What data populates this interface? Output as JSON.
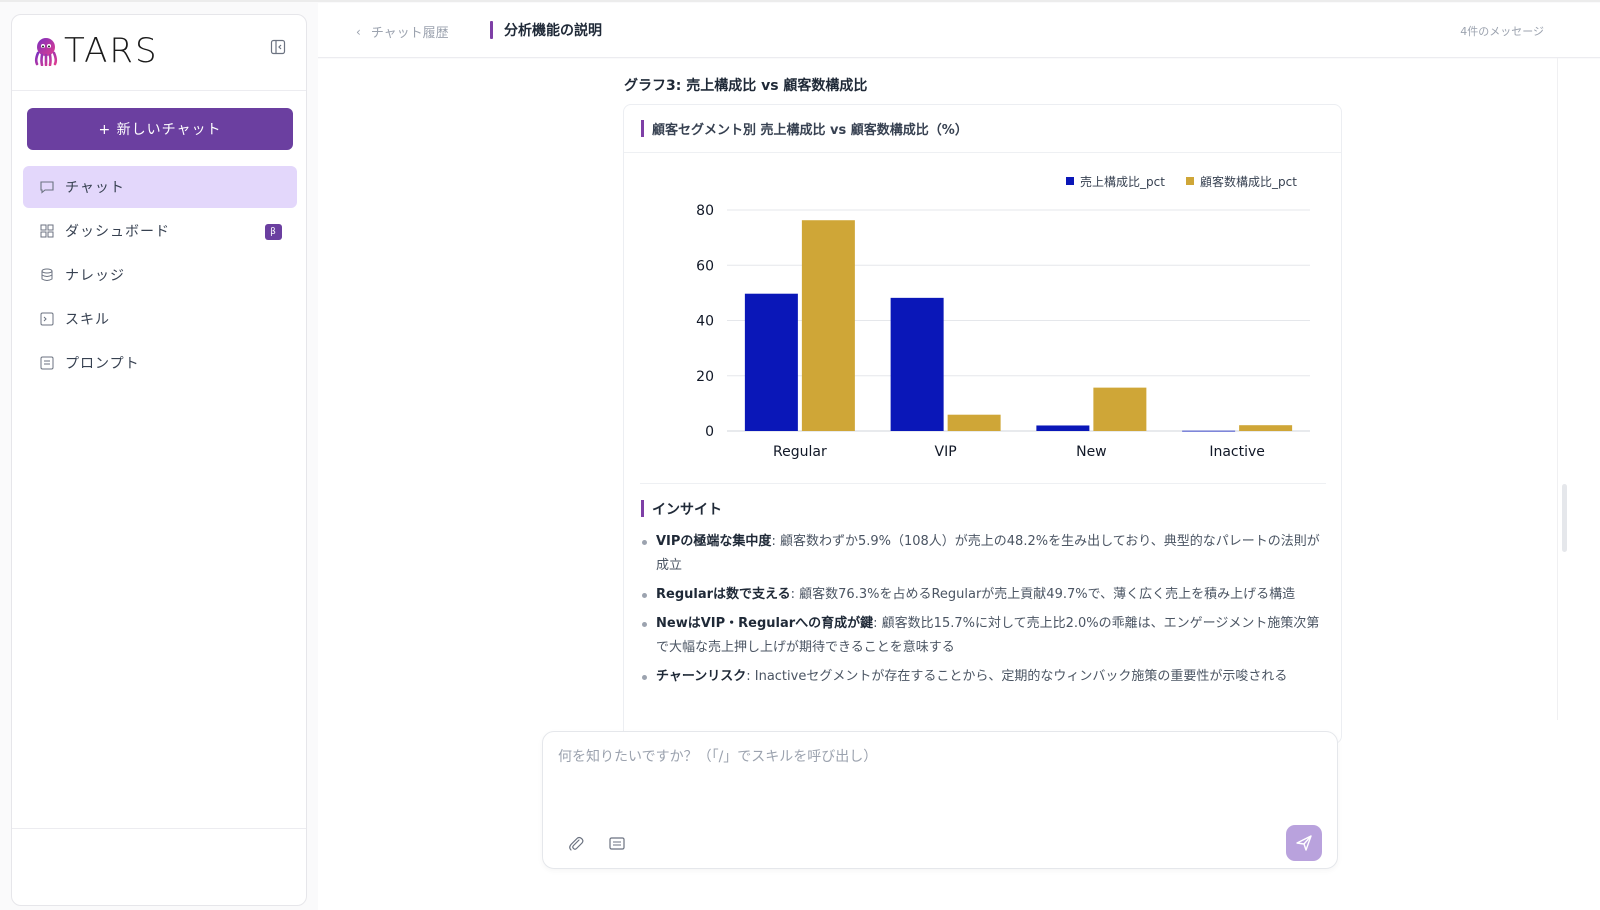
{
  "app": {
    "brand": "TARS"
  },
  "sidebar": {
    "new_chat_label": "+ 新しいチャット",
    "items": [
      {
        "label": "チャット",
        "icon": "chat-icon",
        "active": true
      },
      {
        "label": "ダッシュボード",
        "icon": "dashboard-icon",
        "badge": "β"
      },
      {
        "label": "ナレッジ",
        "icon": "database-icon"
      },
      {
        "label": "スキル",
        "icon": "terminal-icon"
      },
      {
        "label": "プロンプト",
        "icon": "prompt-icon"
      }
    ]
  },
  "header": {
    "back_label": "チャット履歴",
    "title": "分析機能の説明",
    "message_count": "4件のメッセージ"
  },
  "main": {
    "section_title": "グラフ3: 売上構成比 vs 顧客数構成比",
    "card_title": "顧客セグメント別 売上構成比 vs 顧客数構成比（%）",
    "insight_heading": "インサイト",
    "insights": [
      {
        "bold": "VIPの極端な集中度",
        "text": ": 顧客数わずか5.9%（108人）が売上の48.2%を生み出しており、典型的なパレートの法則が成立"
      },
      {
        "bold": "Regularは数で支える",
        "text": ": 顧客数76.3%を占めるRegularが売上貢献49.7%で、薄く広く売上を積み上げる構造"
      },
      {
        "bold": "NewはVIP・Regularへの育成が鍵",
        "text": ": 顧客数比15.7%に対して売上比2.0%の乖離は、エンゲージメント施策次第で大幅な売上押し上げが期待できることを意味する"
      },
      {
        "bold": "チャーンリスク",
        "text": ": Inactiveセグメントが存在することから、定期的なウィンバック施策の重要性が示唆される"
      }
    ]
  },
  "composer": {
    "placeholder": "何を知りたいですか？（「/」でスキルを呼び出し）"
  },
  "colors": {
    "accent": "#6b3fa0",
    "series_sales": "#0a17b8",
    "series_customers": "#cfa637"
  },
  "chart_data": {
    "type": "bar",
    "title": "顧客セグメント別 売上構成比 vs 顧客数構成比（%）",
    "categories": [
      "Regular",
      "VIP",
      "New",
      "Inactive"
    ],
    "series": [
      {
        "name": "売上構成比_pct",
        "values": [
          49.7,
          48.2,
          2.0,
          0.1
        ]
      },
      {
        "name": "顧客数構成比_pct",
        "values": [
          76.3,
          5.9,
          15.7,
          2.1
        ]
      }
    ],
    "yticks": [
      0,
      20,
      40,
      60,
      80
    ],
    "ylim": [
      0,
      80
    ],
    "grid": true,
    "legend": "top-right"
  }
}
